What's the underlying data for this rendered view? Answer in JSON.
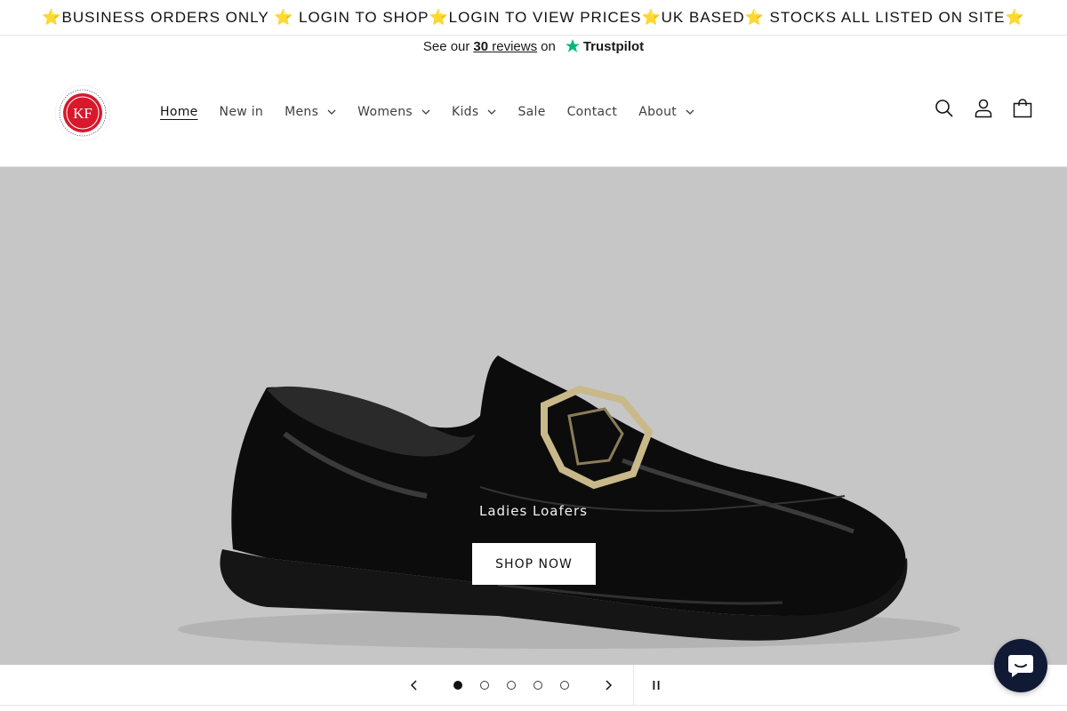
{
  "announcement": {
    "text": "⭐BUSINESS ORDERS ONLY ⭐ LOGIN TO SHOP⭐LOGIN TO VIEW PRICES⭐UK BASED⭐ STOCKS ALL LISTED ON SITE⭐"
  },
  "trustpilot": {
    "prefix": "See our",
    "count": "30",
    "reviews": "reviews",
    "suffix": "on",
    "brand": "Trustpilot",
    "star_color": "#00b67a"
  },
  "header": {
    "logo": {
      "text_ring": "KENTONS FOOTWEAR · IMPORT · WHOLESALE · DISTRIBUTION",
      "monogram": "KF",
      "color": "#d7192b"
    },
    "nav": [
      {
        "label": "Home",
        "active": true,
        "dropdown": false
      },
      {
        "label": "New in",
        "active": false,
        "dropdown": false
      },
      {
        "label": "Mens",
        "active": false,
        "dropdown": true
      },
      {
        "label": "Womens",
        "active": false,
        "dropdown": true
      },
      {
        "label": "Kids",
        "active": false,
        "dropdown": true
      },
      {
        "label": "Sale",
        "active": false,
        "dropdown": false
      },
      {
        "label": "Contact",
        "active": false,
        "dropdown": false
      },
      {
        "label": "About",
        "active": false,
        "dropdown": true
      }
    ],
    "icons": [
      "search-icon",
      "account-icon",
      "cart-icon"
    ]
  },
  "hero": {
    "caption": "Ladies Loafers",
    "button": "SHOP NOW",
    "background": "#c6c6c6",
    "product_image": "black-patent-loafer-shoe"
  },
  "slider": {
    "slide_count": 5,
    "active_slide": 1,
    "controls": [
      "previous-arrow-icon",
      "next-arrow-icon",
      "pause-icon"
    ]
  },
  "chat": {
    "icon": "chat-bubble-icon",
    "color": "#111a35"
  }
}
